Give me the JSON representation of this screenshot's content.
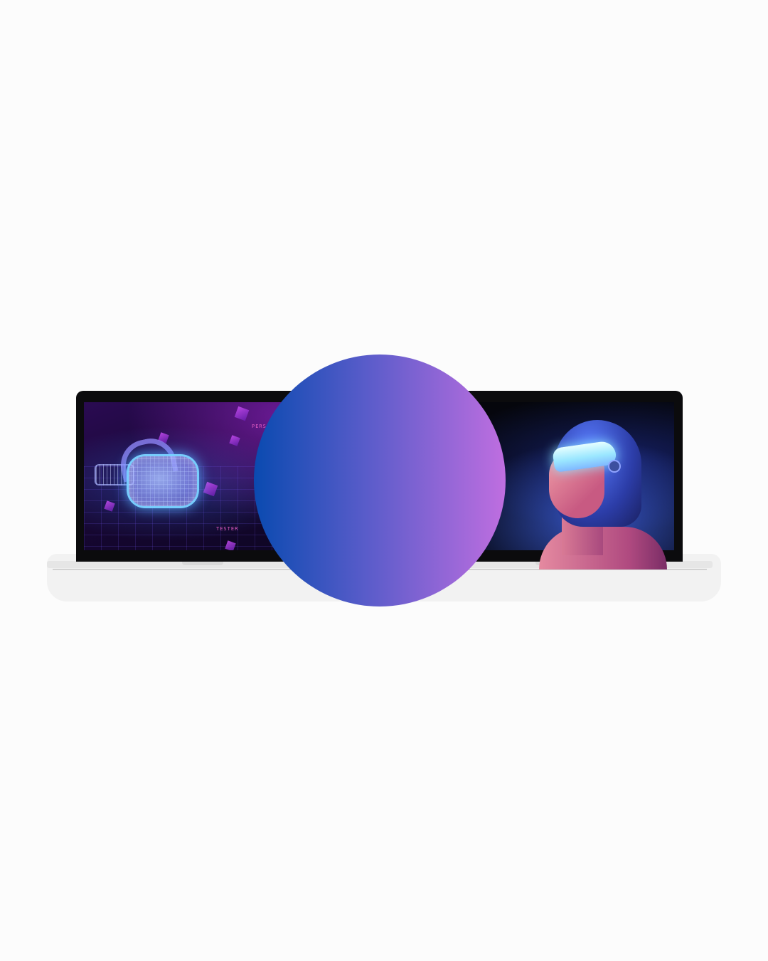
{
  "left_screen": {
    "label_1": "PERSP",
    "label_2": "TESTER"
  },
  "colors": {
    "background": "#fcfcfc",
    "orb_gradient_start": "#0a4ab0",
    "orb_gradient_end": "#bf6ee0"
  }
}
